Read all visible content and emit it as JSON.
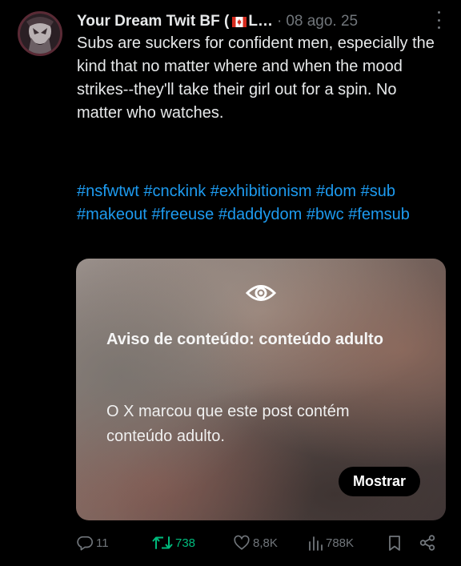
{
  "post": {
    "author": {
      "display_name": "Your Dream Twit BF (",
      "truncated_suffix": "L…",
      "flag_icon": "canada-flag-icon"
    },
    "separator": "·",
    "timestamp": "08 ago. 25",
    "text": "Subs are suckers for confident men, especially the kind that no matter where and when the mood strikes--they'll take their girl out for a spin. No matter who watches.",
    "hashtags": [
      "#nsfwtwt",
      "#cnckink",
      "#exhibitionism",
      "#dom",
      "#sub",
      "#makeout",
      "#freeuse",
      "#daddydom",
      "#bwc",
      "#femsub"
    ],
    "content_warning": {
      "icon": "eye-icon",
      "title": "Aviso de conteúdo: conteúdo adulto",
      "body": "O X marcou que este post contém conteúdo adulto.",
      "show_label": "Mostrar"
    },
    "actions": {
      "replies": "11",
      "reposts": "738",
      "likes": "8,8K",
      "views": "788K"
    }
  },
  "colors": {
    "background": "#000000",
    "text": "#e7e9ea",
    "secondary": "#71767b",
    "link": "#1d9bf0",
    "repost_active": "#00ba7c"
  }
}
